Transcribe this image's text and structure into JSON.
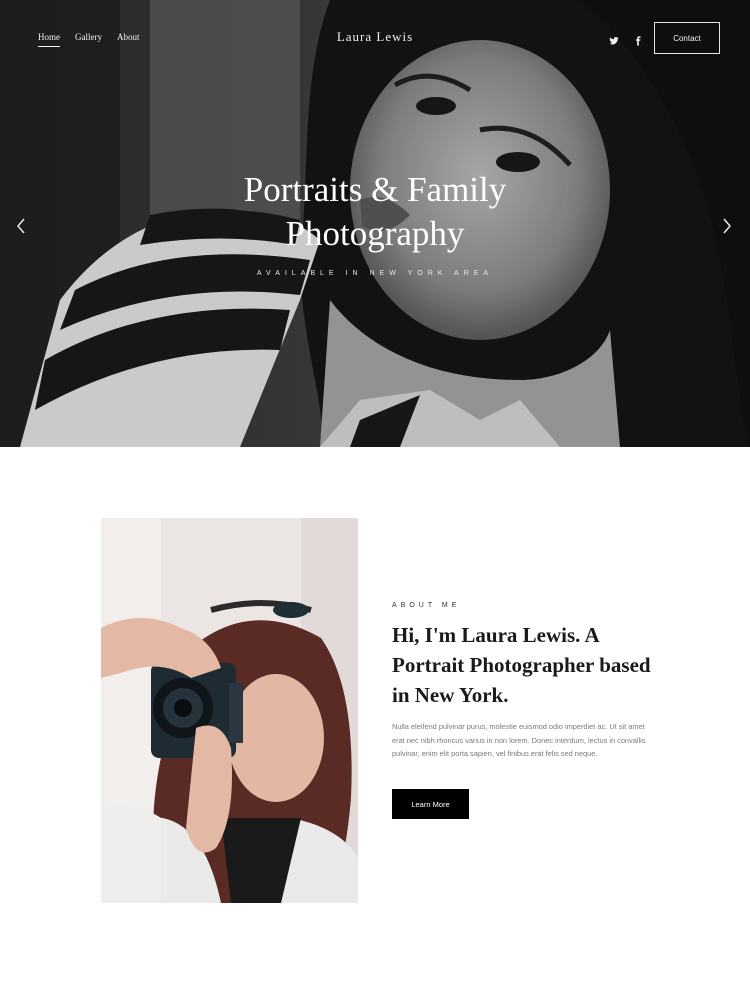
{
  "nav": {
    "items": [
      {
        "label": "Home",
        "active": true
      },
      {
        "label": "Gallery",
        "active": false
      },
      {
        "label": "About",
        "active": false
      }
    ]
  },
  "brand": {
    "name": "Laura Lewis"
  },
  "social": {
    "icons": [
      "twitter-icon",
      "facebook-icon"
    ]
  },
  "header": {
    "contact_label": "Contact"
  },
  "hero": {
    "title_line1": "Portraits & Family",
    "title_line2": "Photography",
    "subtitle": "AVAILABLE IN NEW YORK AREA",
    "prev_icon": "chevron-left-icon",
    "next_icon": "chevron-right-icon"
  },
  "about": {
    "eyebrow": "ABOUT ME",
    "heading": "Hi, I'm Laura Lewis. A Portrait Photographer based in New York.",
    "body": "Nulla eleifend pulvinar purus, molestie euismod odio imperdiet ac. Ut sit amet erat nec nibh rhoncus varius in non lorem. Donec interdum, lectus in convallis pulvinar, enim elit porta sapien, vel finibus erat felis sed neque.",
    "button_label": "Learn More"
  },
  "colors": {
    "hero_text": "#ffffff",
    "button_bg": "#000000",
    "body_text": "#7a7a7a"
  }
}
